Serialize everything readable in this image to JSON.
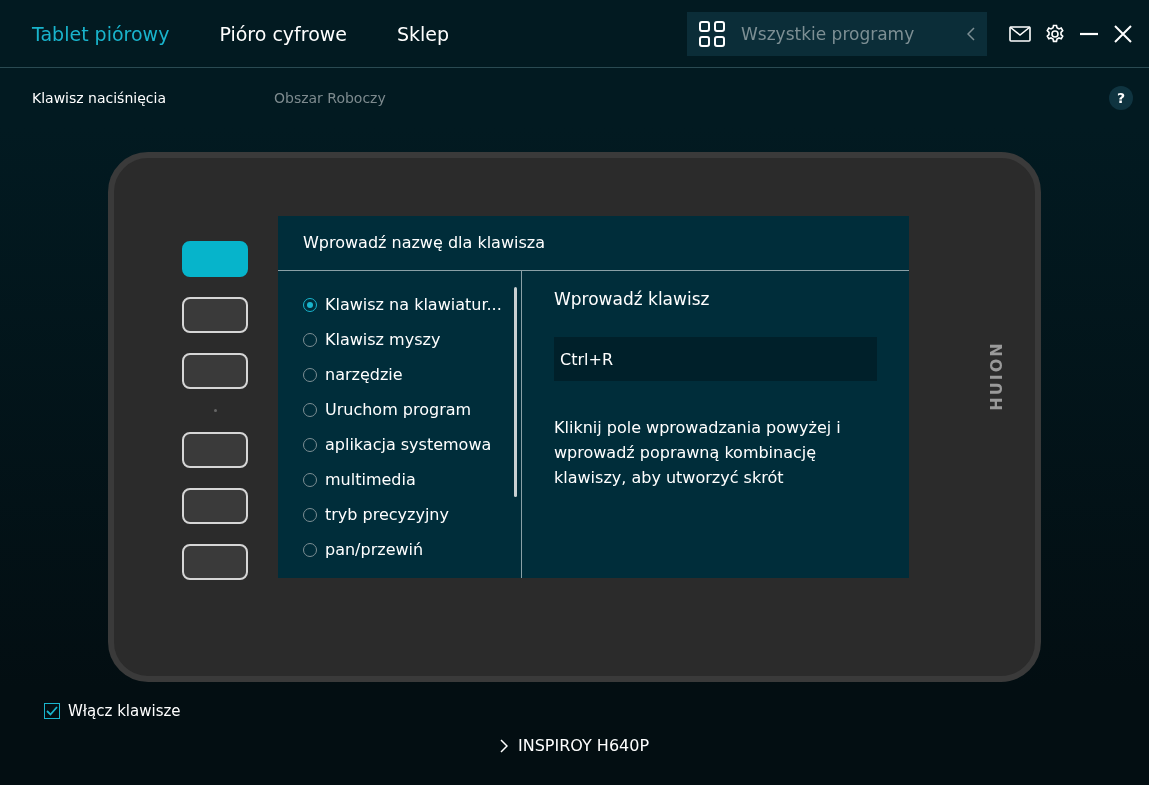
{
  "tabs": [
    {
      "label": "Tablet piórowy",
      "selected": true
    },
    {
      "label": "Pióro cyfrowe",
      "selected": false
    },
    {
      "label": "Sklep",
      "selected": false
    }
  ],
  "app_selector": {
    "placeholder": "Wszystkie programy"
  },
  "subtabs": [
    {
      "label": "Klawisz naciśnięcia",
      "selected": true
    },
    {
      "label": "Obszar Roboczy",
      "selected": false
    }
  ],
  "help": "?",
  "tablet": {
    "logo": "HUION",
    "keys": [
      {
        "selected": true
      },
      {
        "selected": false
      },
      {
        "selected": false
      },
      {
        "selected": false
      },
      {
        "selected": false
      },
      {
        "selected": false
      }
    ]
  },
  "dialog": {
    "title": "Wprowadź nazwę dla klawisza",
    "options": [
      {
        "label": "Klawisz na klawiatur...",
        "selected": true
      },
      {
        "label": "Klawisz myszy",
        "selected": false
      },
      {
        "label": "narzędzie",
        "selected": false
      },
      {
        "label": "Uruchom program",
        "selected": false
      },
      {
        "label": "aplikacja systemowa",
        "selected": false
      },
      {
        "label": "multimedia",
        "selected": false
      },
      {
        "label": "tryb precyzyjny",
        "selected": false
      },
      {
        "label": "pan/przewiń",
        "selected": false
      }
    ],
    "key_heading": "Wprowadź klawisz",
    "key_value": "Ctrl+R",
    "hint": "Kliknij pole wprowadzania powyżej i wprowadź poprawną kombinację klawiszy, aby utworzyć skrót"
  },
  "enable_keys": {
    "label": "Włącz klawisze",
    "checked": true
  },
  "device": "INSPIROY H640P"
}
